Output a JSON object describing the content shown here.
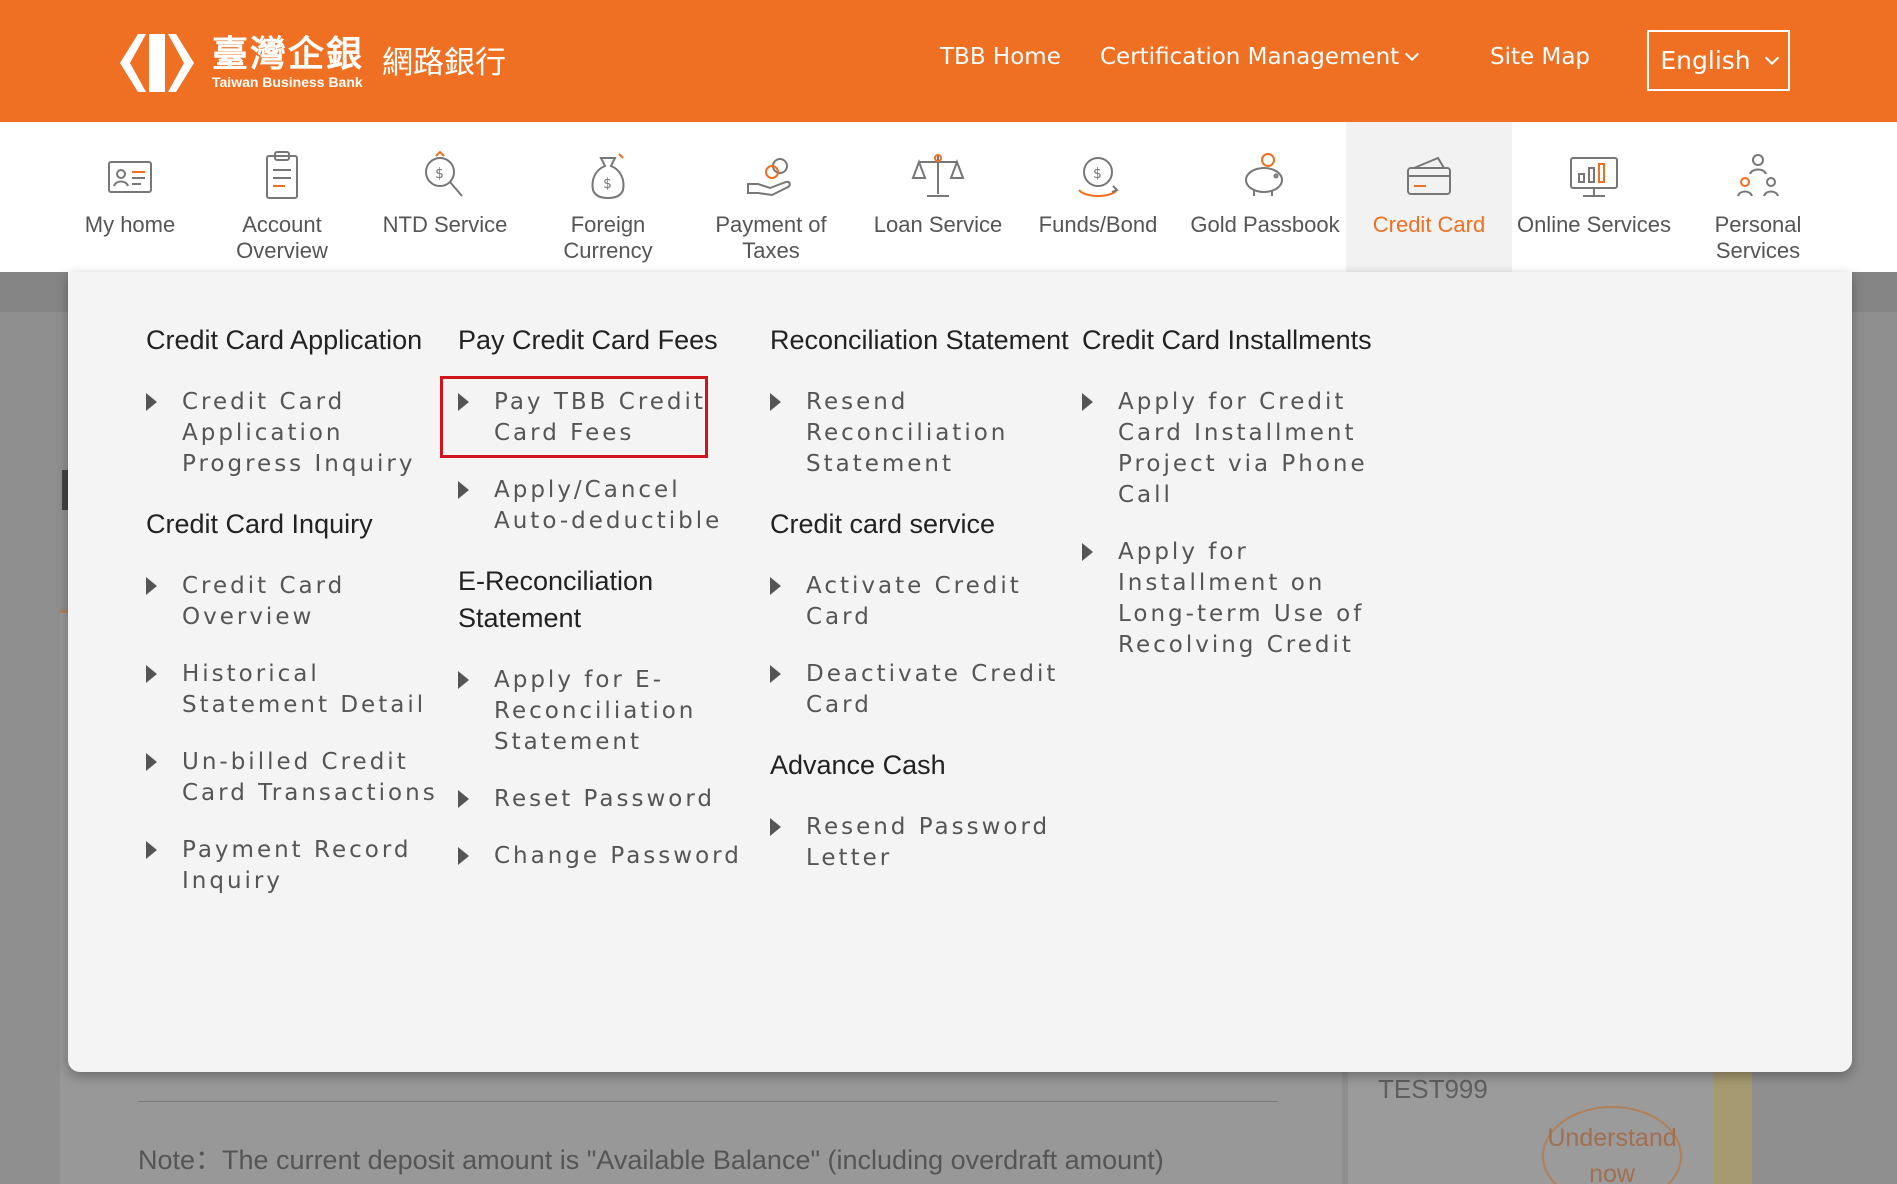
{
  "header": {
    "logo_cn": "臺灣企銀",
    "logo_en": "Taiwan Business Bank",
    "logo_sub": "網路銀行",
    "nav": [
      "TBB Home",
      "Certification Management",
      "Site Map"
    ],
    "language": "English"
  },
  "menu": [
    {
      "label": "My home",
      "icon": "id-card-icon"
    },
    {
      "label": "Account Overview",
      "icon": "clipboard-icon"
    },
    {
      "label": "NTD Service",
      "icon": "magnify-dollar-icon"
    },
    {
      "label": "Foreign Currency",
      "icon": "money-bag-icon"
    },
    {
      "label": "Payment of Taxes",
      "icon": "hand-coin-icon"
    },
    {
      "label": "Loan Service",
      "icon": "scale-icon"
    },
    {
      "label": "Funds/Bond",
      "icon": "coin-cycle-icon"
    },
    {
      "label": "Gold Passbook",
      "icon": "piggy-bank-icon"
    },
    {
      "label": "Credit Card",
      "icon": "credit-card-icon",
      "active": true
    },
    {
      "label": "Online Services",
      "icon": "monitor-chart-icon"
    },
    {
      "label": "Personal Services",
      "icon": "people-icon"
    }
  ],
  "dropdown": {
    "columns": [
      [
        {
          "title": "Credit Card Application",
          "links": [
            "Credit Card Application Progress Inquiry"
          ]
        },
        {
          "title": "Credit Card Inquiry",
          "links": [
            "Credit Card Overview",
            "Historical Statement Detail",
            "Un-billed Credit Card Transactions",
            "Payment Record Inquiry"
          ]
        }
      ],
      [
        {
          "title": "Pay Credit Card Fees",
          "links": [
            "Pay TBB Credit Card Fees",
            "Apply/Cancel Auto-deductible"
          ]
        },
        {
          "title": "E-Reconciliation Statement",
          "links": [
            "Apply for E-Reconciliation Statement",
            "Reset Password",
            "Change Password"
          ]
        }
      ],
      [
        {
          "title": "Reconciliation Statement",
          "links": [
            "Resend Reconciliation Statement"
          ]
        },
        {
          "title": "Credit card service",
          "links": [
            "Activate Credit Card",
            "Deactivate Credit Card"
          ]
        },
        {
          "title": "Advance Cash",
          "links": [
            "Resend Password Letter"
          ]
        }
      ],
      [
        {
          "title": "Credit Card Installments",
          "links": [
            "Apply for Credit Card Installment Project via Phone Call",
            "Apply for Installment on Long-term Use of Recolving Credit"
          ]
        }
      ]
    ]
  },
  "background": {
    "note": "Note：The current deposit amount is \"Available Balance\" (including overdraft amount)",
    "account": "TEST999",
    "understand_button": "Understand now"
  }
}
